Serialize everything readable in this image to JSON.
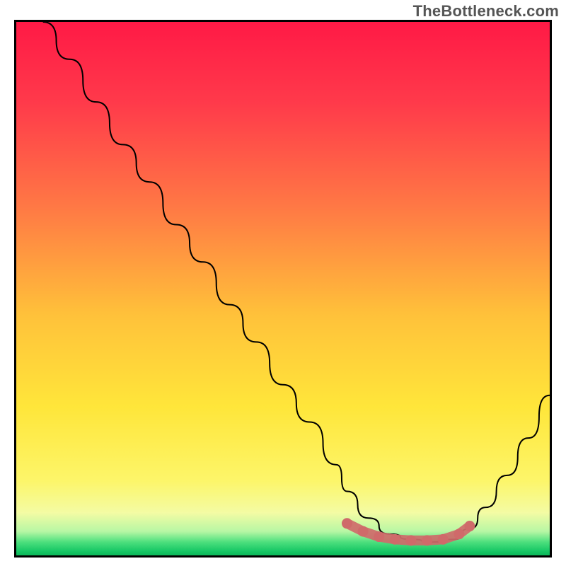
{
  "watermark": "TheBottleneck.com",
  "chart_data": {
    "type": "line",
    "title": "",
    "xlabel": "",
    "ylabel": "",
    "xlim": [
      0,
      100
    ],
    "ylim": [
      0,
      100
    ],
    "gradient_stops": [
      {
        "pos": 0.0,
        "color": "#ff1a46"
      },
      {
        "pos": 0.15,
        "color": "#ff3a4b"
      },
      {
        "pos": 0.35,
        "color": "#ff7a45"
      },
      {
        "pos": 0.55,
        "color": "#ffc23a"
      },
      {
        "pos": 0.72,
        "color": "#ffe63a"
      },
      {
        "pos": 0.86,
        "color": "#fdf66a"
      },
      {
        "pos": 0.92,
        "color": "#f4fca4"
      },
      {
        "pos": 0.955,
        "color": "#b8f7a5"
      },
      {
        "pos": 0.975,
        "color": "#4de07e"
      },
      {
        "pos": 0.992,
        "color": "#17c765"
      },
      {
        "pos": 1.0,
        "color": "#0bb85a"
      }
    ],
    "series": [
      {
        "name": "bottleneck-curve",
        "color": "#000000",
        "width": 2,
        "x": [
          5,
          10,
          15,
          20,
          25,
          30,
          35,
          40,
          45,
          50,
          55,
          60,
          62,
          66,
          70,
          74,
          78,
          82,
          85,
          88,
          92,
          96,
          100
        ],
        "y": [
          100,
          93,
          85,
          77,
          70,
          62,
          55,
          47,
          40,
          32,
          25,
          17,
          12,
          7,
          4,
          3,
          2.5,
          3,
          5,
          9,
          15,
          22,
          30
        ]
      },
      {
        "name": "highlight-band",
        "color": "#cf6a6a",
        "type": "scatter",
        "marker_size": 10,
        "x": [
          62,
          65,
          68,
          71,
          74,
          77,
          80,
          83,
          85
        ],
        "y": [
          6,
          4.5,
          3.5,
          3,
          2.8,
          2.8,
          3,
          4,
          5.5
        ]
      }
    ]
  }
}
